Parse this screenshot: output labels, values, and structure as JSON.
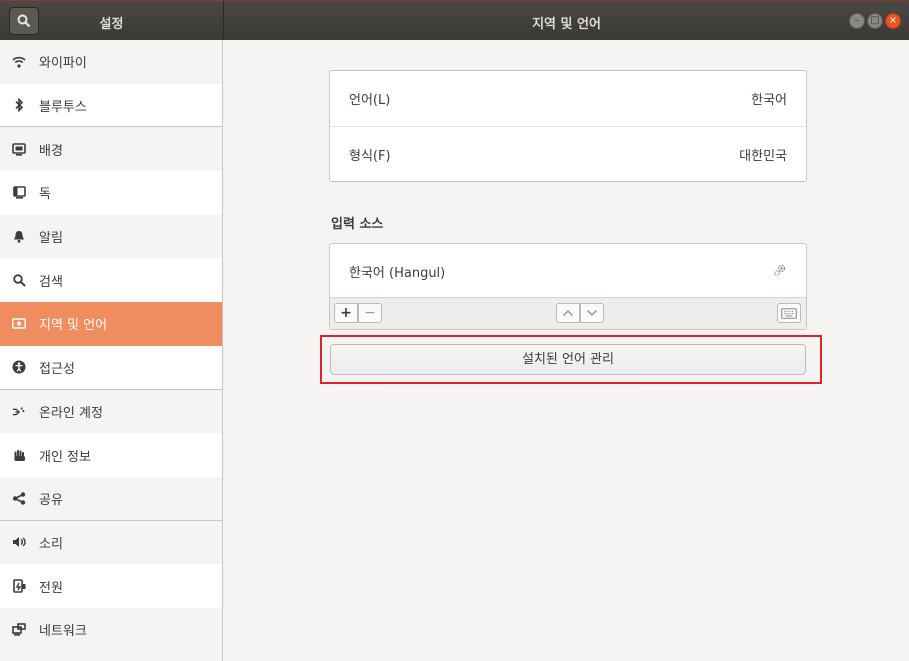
{
  "header": {
    "left_title": "설정",
    "main_title": "지역 및 언어",
    "close_glyph": "×"
  },
  "sidebar": {
    "items": [
      {
        "label": "와이파이",
        "icon": "wifi-icon"
      },
      {
        "label": "블루투스",
        "icon": "bluetooth-icon"
      },
      {
        "label": "배경",
        "icon": "background-icon"
      },
      {
        "label": "독",
        "icon": "dock-icon"
      },
      {
        "label": "알림",
        "icon": "bell-icon"
      },
      {
        "label": "검색",
        "icon": "search-icon"
      },
      {
        "label": "지역 및 언어",
        "icon": "region-flag-icon",
        "selected": true
      },
      {
        "label": "접근성",
        "icon": "accessibility-icon"
      },
      {
        "label": "온라인 계정",
        "icon": "online-accounts-icon"
      },
      {
        "label": "개인 정보",
        "icon": "privacy-hand-icon"
      },
      {
        "label": "공유",
        "icon": "share-icon"
      },
      {
        "label": "소리",
        "icon": "speaker-icon"
      },
      {
        "label": "전원",
        "icon": "power-icon"
      },
      {
        "label": "네트워크",
        "icon": "network-icon"
      }
    ]
  },
  "main": {
    "language": {
      "label": "언어(L)",
      "value": "한국어"
    },
    "formats": {
      "label": "형식(F)",
      "value": "대한민국"
    },
    "input_sources_title": "입력 소스",
    "input_sources": [
      {
        "label": "한국어 (Hangul)"
      }
    ],
    "toolbar": {
      "add": "+",
      "remove": "−",
      "up": "⌃",
      "down": "⌄"
    },
    "manage_button": "설치된 언어 관리"
  },
  "colors": {
    "accent": "#f08d5e",
    "header_bg": "#3a3935",
    "close_button": "#e95420",
    "highlight_border": "#d9262b"
  }
}
